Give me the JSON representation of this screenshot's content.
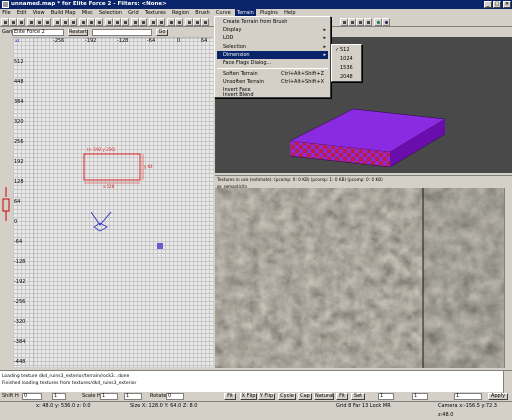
{
  "window": {
    "title": "unnamed.map * for Elite Force 2 - Filters: <None>",
    "minimize": "_",
    "maximize": "□",
    "close": "×"
  },
  "menubar": [
    "File",
    "Edit",
    "View",
    "Build Map",
    "Misc",
    "Selection",
    "Grid",
    "Textures",
    "Region",
    "Brush",
    "Curve",
    "Terrain",
    "Plugins",
    "Help"
  ],
  "terrain_menu": {
    "items": [
      {
        "label": "Create Terrain from Brush",
        "shortcut": "",
        "arrow": ""
      },
      {
        "label": "Display",
        "shortcut": "",
        "arrow": "▸"
      },
      {
        "label": "LOD",
        "shortcut": "",
        "arrow": "▸"
      },
      {
        "label": "Selection",
        "shortcut": "",
        "arrow": "▸"
      },
      {
        "label": "Dimension",
        "shortcut": "",
        "arrow": "▸"
      },
      {
        "label": "Face Flags Dialog...",
        "shortcut": "",
        "arrow": ""
      },
      {
        "label": "Soften Terrain",
        "shortcut": "Ctrl+Alt+Shift+Z",
        "arrow": ""
      },
      {
        "label": "Unsoften Terrain",
        "shortcut": "Ctrl+Alt+Shift+X",
        "arrow": ""
      },
      {
        "label": "Invert Face",
        "shortcut": "",
        "arrow": ""
      },
      {
        "label": "Invert Blend",
        "shortcut": "",
        "arrow": ""
      }
    ]
  },
  "dimension_submenu": {
    "items": [
      "512",
      "1024",
      "1536",
      "2048"
    ],
    "checked": "512",
    "check_mark": "✓"
  },
  "gamebar": {
    "game_label": "Game",
    "game_value": "Elite Force 2",
    "restart": "Restart",
    "go": "Go"
  },
  "grid_view": {
    "top_ticks": [
      "-256",
      "-192",
      "-128",
      "-64",
      "0",
      "64"
    ],
    "left_ticks": [
      "512",
      "448",
      "384",
      "320",
      "256",
      "192",
      "128",
      "64",
      "0",
      "-64",
      "-128",
      "-192",
      "-256",
      "-320",
      "-384",
      "-448"
    ],
    "brush_dims": {
      "xy": "(x -192 y 256)",
      "width": "x 128",
      "height": "y 64"
    },
    "xyz_label": "xz"
  },
  "texture_bar": {
    "text": "Textures in use (estimate): (pcomp: 0: 0 KB) (pcomp: 1: 0 KB) (pcomp: 0: 0 KB)",
    "path": "gs_semantic/ty"
  },
  "console": {
    "lines": [
      "Loading texture dkd_ruins3_exterior/terrain/rock3...done",
      "Finished loading textures from textures/dkd_ruins3_exterior"
    ]
  },
  "bottom_bar": {
    "shift_label": "Shift H",
    "shift_value": "0",
    "scale_label": "Scale H",
    "scale_value": "1",
    "rotate_label": "Rotate",
    "rotate_value": "0",
    "buttons": [
      "Fit",
      "X Flip",
      "Y Flip",
      "Cycle",
      "Cap",
      "Natural",
      "Fit",
      "Set",
      "Apply"
    ],
    "v_value": "1"
  },
  "status": {
    "coords": "x: 48.0  y: 536.0  z: 0.0",
    "size": "Size X: 128.0  Y: 64.0  Z: 8.0",
    "grid": "Grid 8  Far 13  Lock MR",
    "camera": "Camera x:-156.5 y:72.3 z:48.0"
  },
  "colors": {
    "titlebar": "#0a246a",
    "selection": "#0a246a",
    "brush": "#e02020",
    "terrain_top": "#8a2be2",
    "terrain_side": "#6a0dad",
    "terrain_checker": "#c01c3c"
  }
}
